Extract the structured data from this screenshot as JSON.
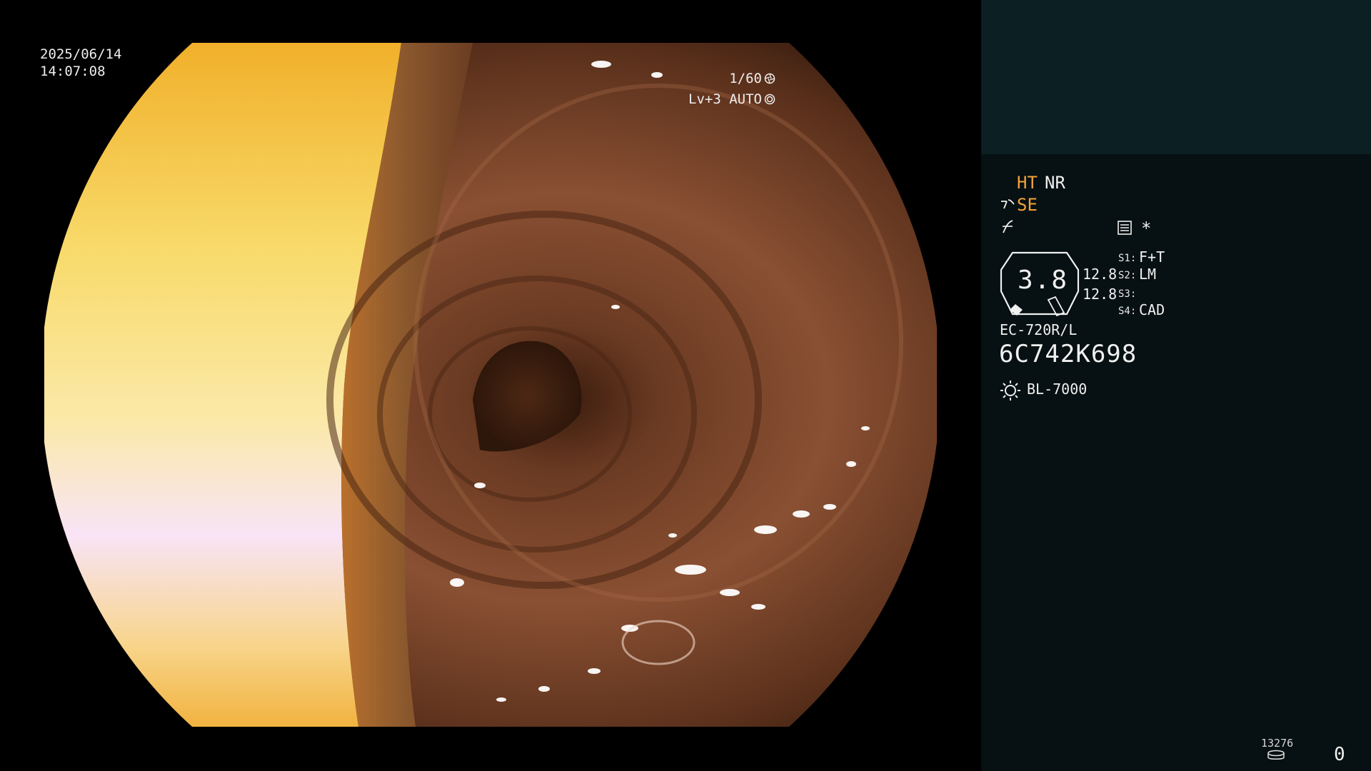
{
  "overlay": {
    "date": "2025/06/14",
    "time": "14:07:08",
    "shutter": "1/60",
    "shutter_icon": "aperture-icon",
    "level": "Lv+3 AUTO",
    "level_icon": "auto-iris-icon"
  },
  "panel": {
    "ht": "HT",
    "nr": "NR",
    "se": "SE",
    "se_icon": "structure-enhance-icon",
    "curve_icon": "gamma-curve-icon",
    "memo_icon": "memo-icon",
    "asterisk": "*",
    "zoom": "3.8",
    "value_top": "12.8",
    "value_bottom": "12.8",
    "switches": [
      {
        "label": "S1:",
        "value": "F+T"
      },
      {
        "label": "S2:",
        "value": "LM"
      },
      {
        "label": "S3:",
        "value": ""
      },
      {
        "label": "S4:",
        "value": "CAD"
      }
    ],
    "model": "EC-720R/L",
    "serial": "6C742K698",
    "light_icon": "light-source-icon",
    "light_source": "BL-7000",
    "counter": "13276",
    "disk_icon": "disk-icon",
    "right_number": "0"
  },
  "colors": {
    "orange_accent": "#f2a33a",
    "panel_top": "#0c1f22",
    "panel_bottom": "#071012",
    "text": "#f0f0f0"
  }
}
